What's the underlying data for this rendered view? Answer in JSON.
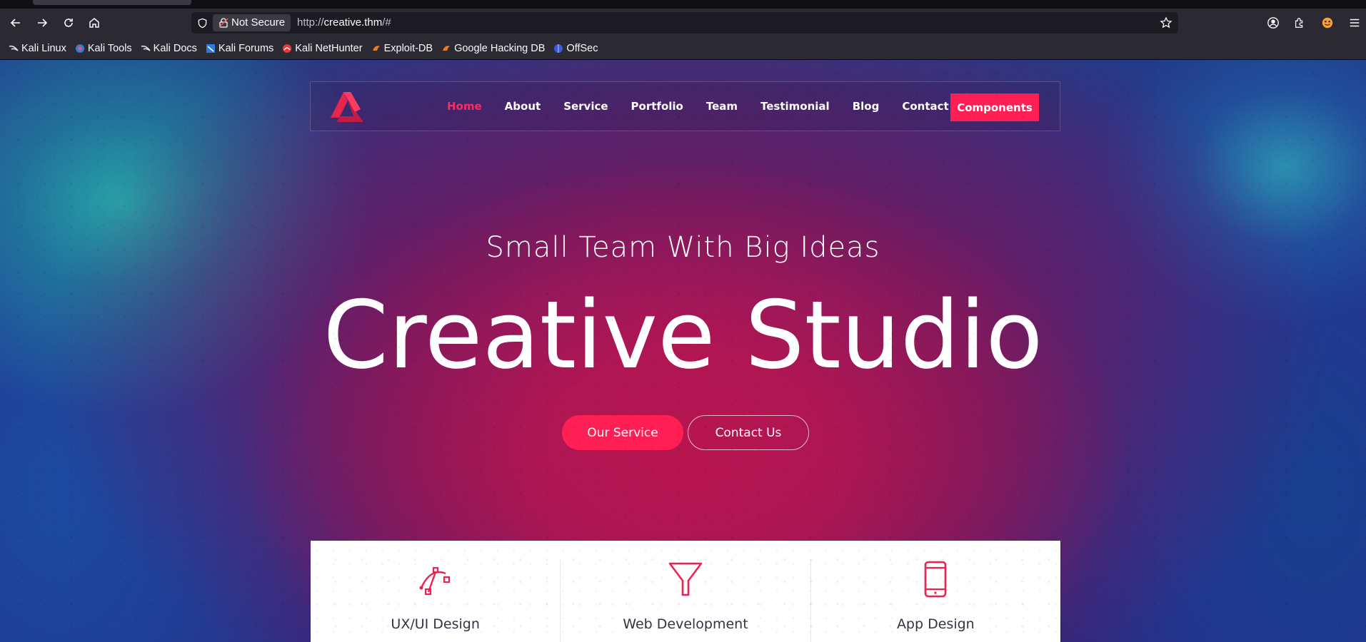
{
  "browser": {
    "security_label": "Not Secure",
    "url_prefix": "http://",
    "url_host": "creative.thm",
    "url_suffix": "/#"
  },
  "bookmarks": [
    {
      "label": "Kali Linux",
      "icon": "kali-icon"
    },
    {
      "label": "Kali Tools",
      "icon": "kali-tools-icon"
    },
    {
      "label": "Kali Docs",
      "icon": "kali-icon"
    },
    {
      "label": "Kali Forums",
      "icon": "kali-forums-icon"
    },
    {
      "label": "Kali NetHunter",
      "icon": "nethunter-icon"
    },
    {
      "label": "Exploit-DB",
      "icon": "exploitdb-icon"
    },
    {
      "label": "Google Hacking DB",
      "icon": "exploitdb-icon"
    },
    {
      "label": "OffSec",
      "icon": "offsec-icon"
    }
  ],
  "site": {
    "nav": [
      "Home",
      "About",
      "Service",
      "Portfolio",
      "Team",
      "Testimonial",
      "Blog",
      "Contact"
    ],
    "components_label": "Components",
    "tagline": "Small Team With Big Ideas",
    "hero_title": "Creative Studio",
    "primary_button": "Our Service",
    "secondary_button": "Contact Us",
    "services": [
      {
        "title": "UX/UI Design",
        "icon": "bezier-pen-icon"
      },
      {
        "title": "Web Development",
        "icon": "funnel-icon"
      },
      {
        "title": "App Design",
        "icon": "mobile-icon"
      }
    ]
  },
  "colors": {
    "accent": "#ff1f55",
    "chrome": "#2b2a33"
  }
}
